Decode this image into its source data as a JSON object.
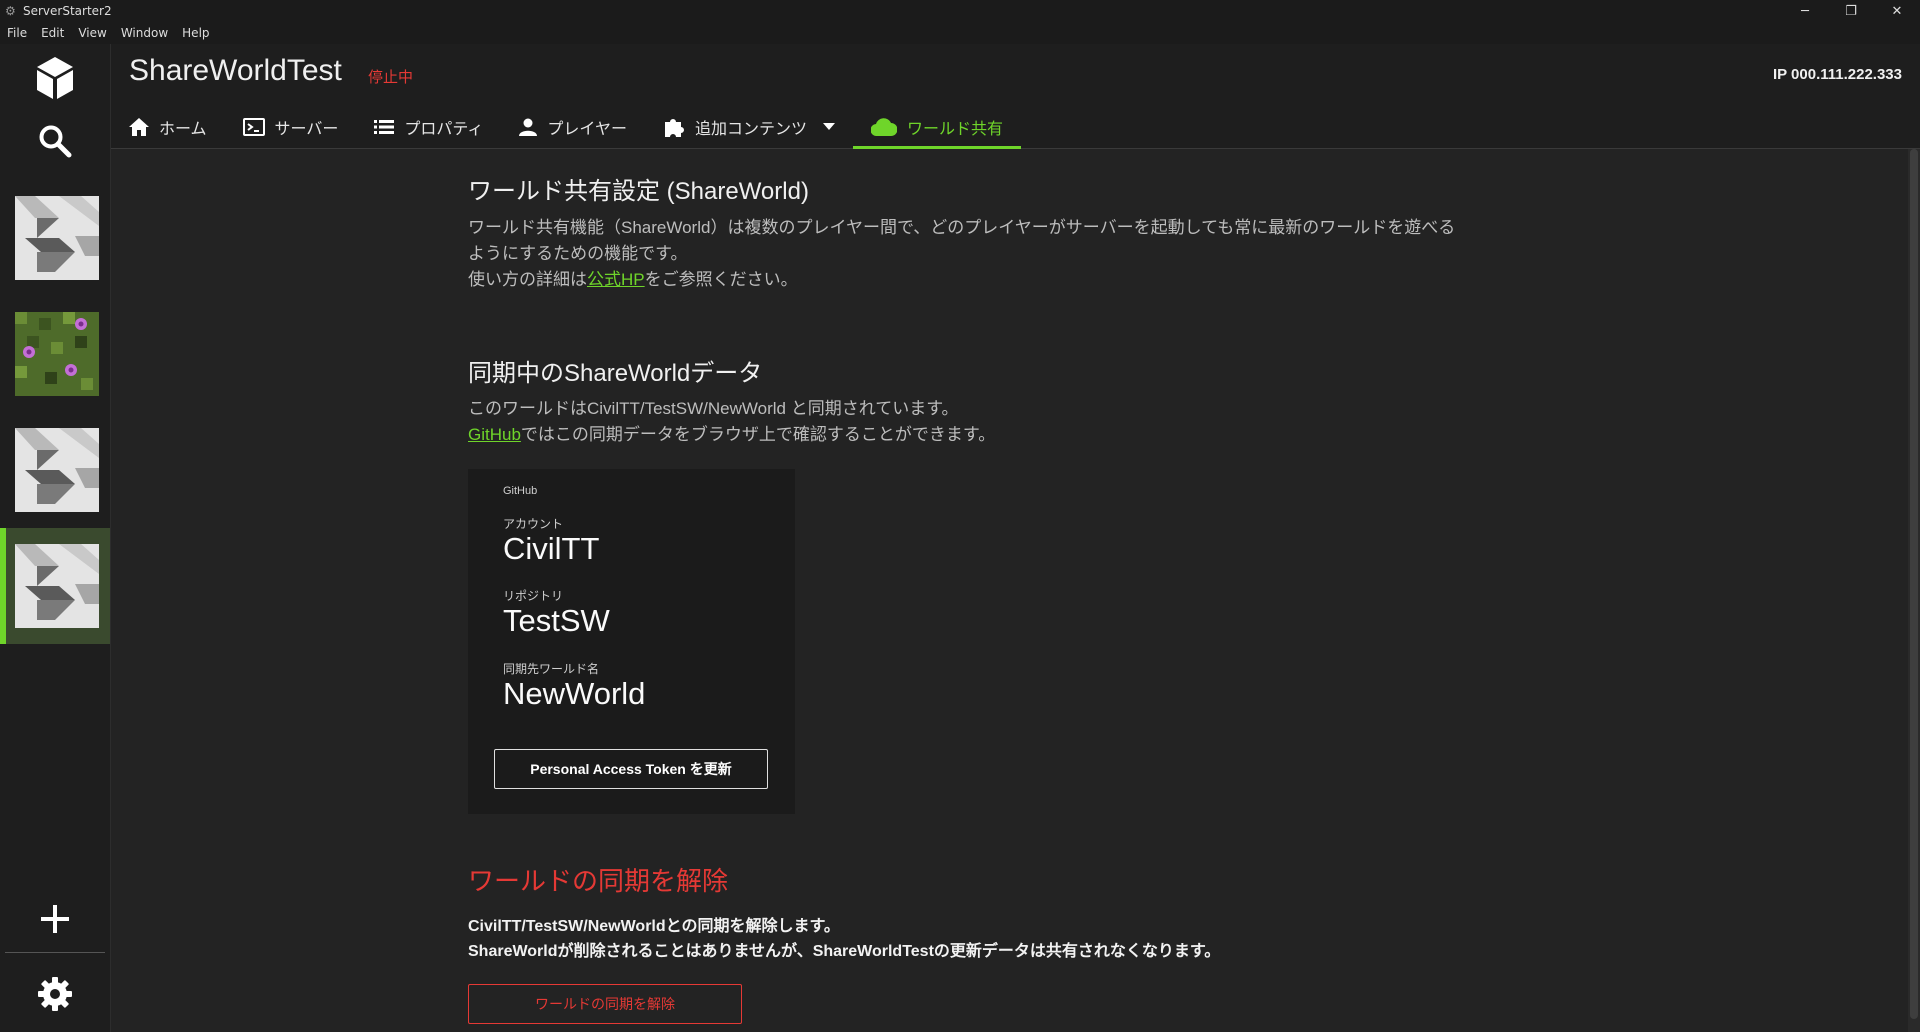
{
  "window": {
    "title": "ServerStarter2",
    "controls": [
      "─",
      "❐",
      "✕"
    ]
  },
  "menubar": {
    "items": [
      "File",
      "Edit",
      "View",
      "Window",
      "Help"
    ]
  },
  "sidebar": {
    "icons": [
      "cube-icon",
      "search-icon",
      "plus-icon",
      "gear-icon"
    ],
    "worlds": [
      {
        "thumbnail": "gray-world-icon"
      },
      {
        "thumbnail": "grass-flower-world-icon"
      },
      {
        "thumbnail": "gray-world-icon"
      },
      {
        "thumbnail": "gray-world-icon",
        "selected": true
      }
    ],
    "accent": "#6fd52a"
  },
  "header": {
    "server_name": "ShareWorldTest",
    "status": "停止中",
    "ip": "IP 000.111.222.333",
    "tabs": [
      {
        "label": "ホーム",
        "icon": "home-icon"
      },
      {
        "label": "サーバー",
        "icon": "console-icon"
      },
      {
        "label": "プロパティ",
        "icon": "list-icon"
      },
      {
        "label": "プレイヤー",
        "icon": "person-icon"
      },
      {
        "label": "追加コンテンツ",
        "icon": "puzzle-icon"
      },
      {
        "label": "ワールド共有",
        "icon": "cloud-icon",
        "active": true
      }
    ]
  },
  "main": {
    "title": "ワールド共有設定 (ShareWorld)",
    "desc_line1": "ワールド共有機能（ShareWorld）は複数のプレイヤー間で、どのプレイヤーがサーバーを起動しても常に最新のワールドを遊べる",
    "desc_line2": "ようにするための機能です。",
    "desc_line3_pre": "使い方の詳細は",
    "desc_line3_link": "公式HP",
    "desc_line3_post": "をご参照ください。",
    "sync_title": "同期中のShareWorldデータ",
    "sync_line1": "このワールドはCivilTT/TestSW/NewWorld と同期されています。",
    "sync_line2_link": "GitHub",
    "sync_line2_post": "ではこの同期データをブラウザ上で確認することができます。",
    "card": {
      "header": "GitHub",
      "account_label": "アカウント",
      "account": "CivilTT",
      "repo_label": "リポジトリ",
      "repo": "TestSW",
      "world_label": "同期先ワールド名",
      "world": "NewWorld",
      "button": "Personal Access Token を更新"
    },
    "unsync_title": "ワールドの同期を解除",
    "unsync_line1": "CivilTT/TestSW/NewWorldとの同期を解除します。",
    "unsync_line2": "ShareWorldが削除されることはありませんが、ShareWorldTestの更新データは共有されなくなります。",
    "unsync_button": "ワールドの同期を解除",
    "danger_color": "#e53935"
  }
}
